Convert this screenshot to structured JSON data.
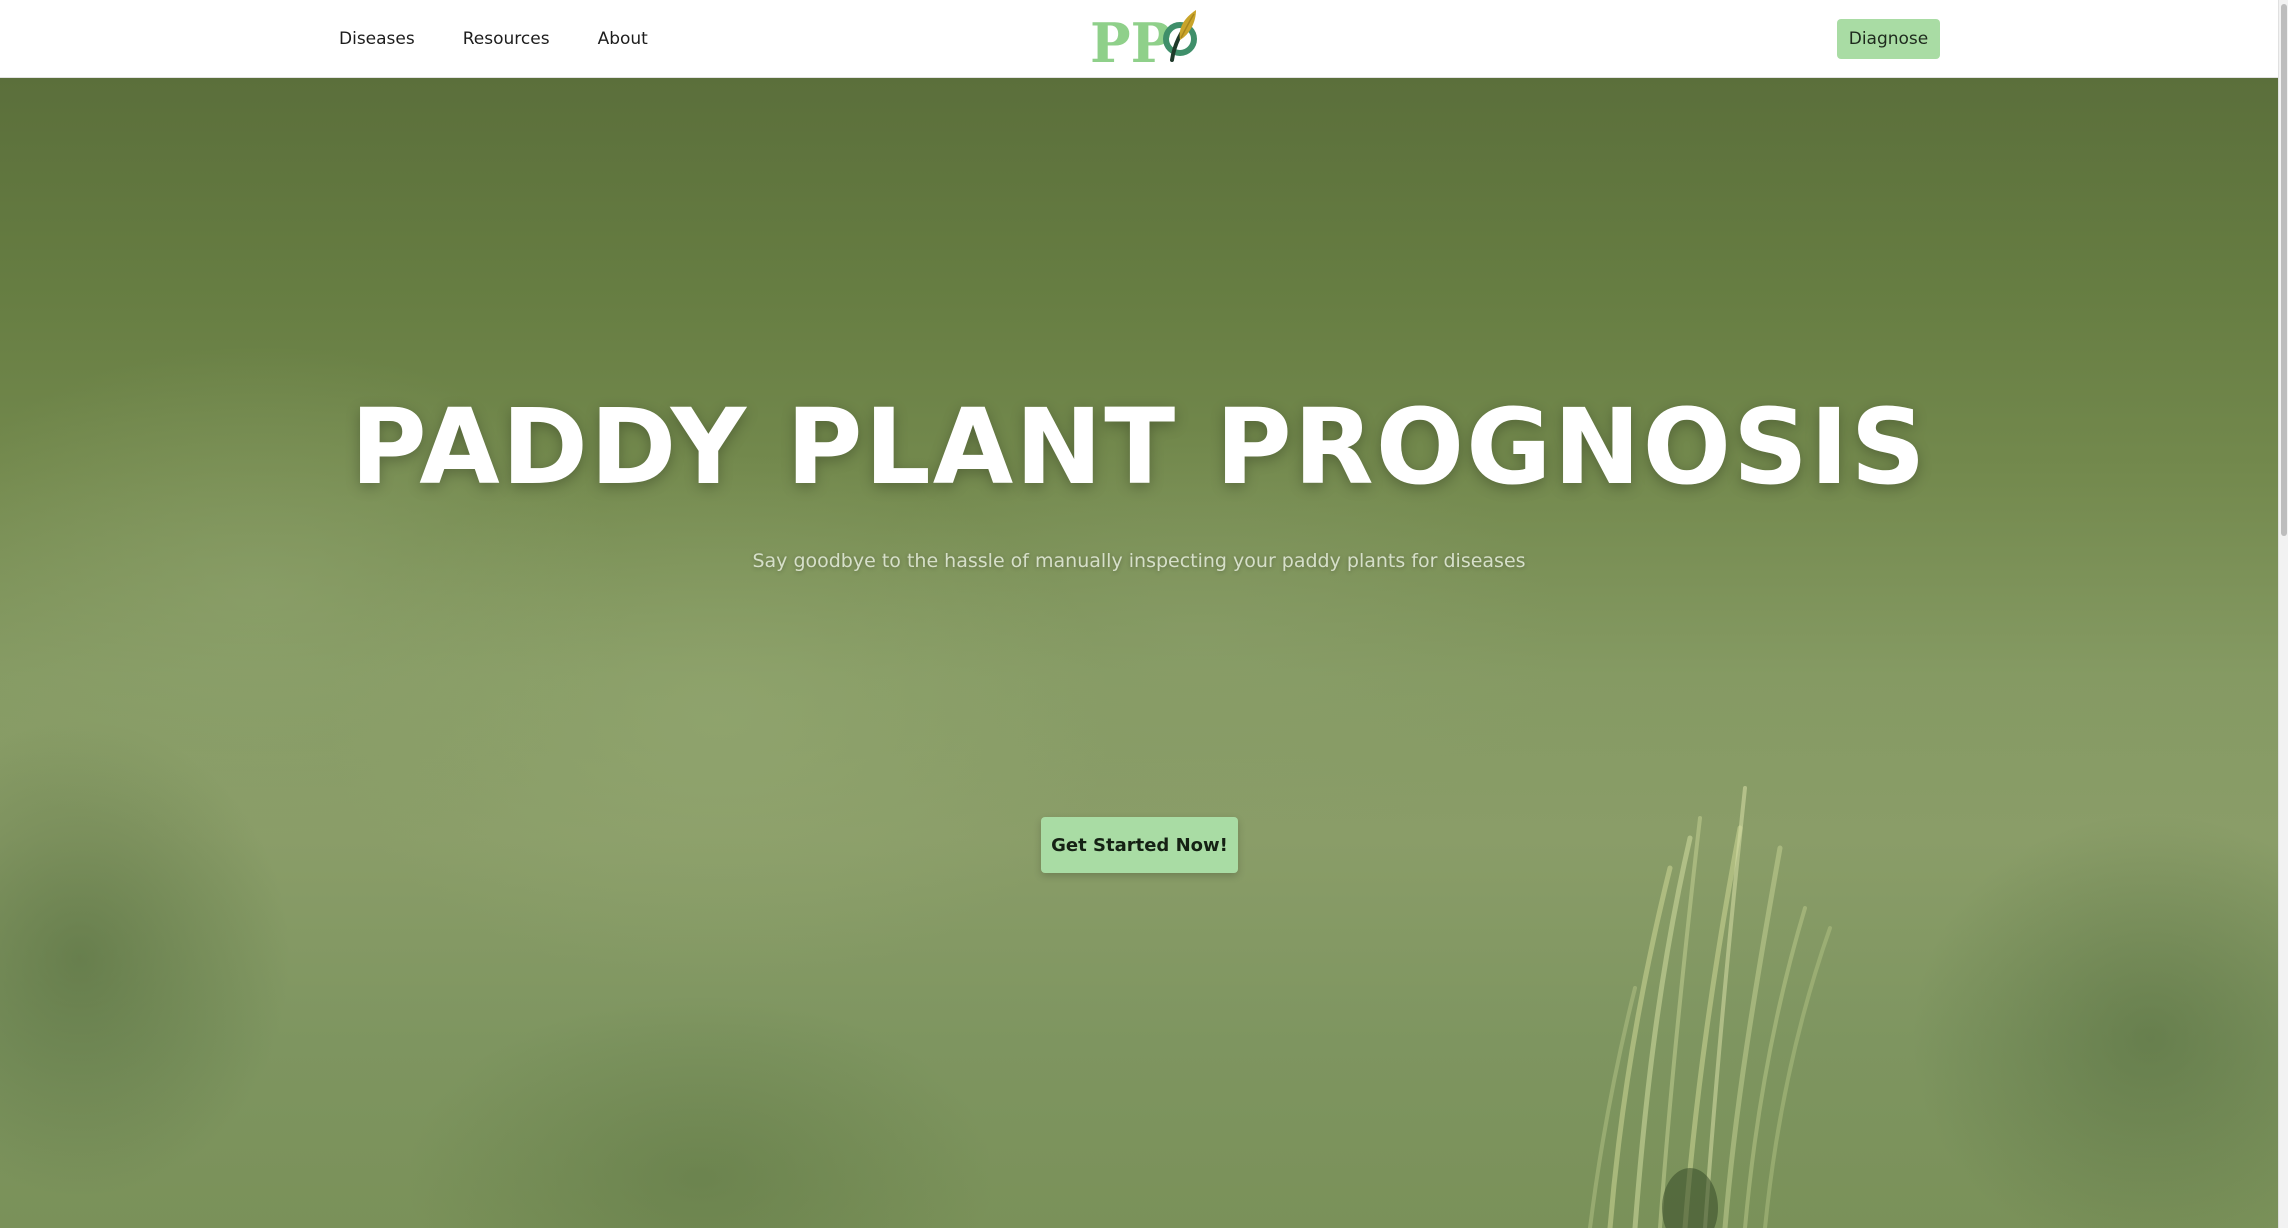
{
  "navbar": {
    "links": [
      {
        "label": "Diseases"
      },
      {
        "label": "Resources"
      },
      {
        "label": "About"
      }
    ],
    "logo_text": "PP",
    "diagnose_label": "Diagnose"
  },
  "hero": {
    "title": "PADDY PLANT PROGNOSIS",
    "subtitle": "Say goodbye to the hassle of manually inspecting your paddy plants for diseases",
    "cta_label": "Get Started Now!"
  },
  "colors": {
    "accent": "#a9dca4",
    "logo_green": "#8fd08a",
    "logo_leaf": "#c9a42a",
    "logo_circle": "#3f8f6a",
    "hero_top": "#5b6f3b",
    "hero_mid": "#8a9d68"
  },
  "icons": {
    "logo": "ppp-leaf-logo-icon"
  }
}
